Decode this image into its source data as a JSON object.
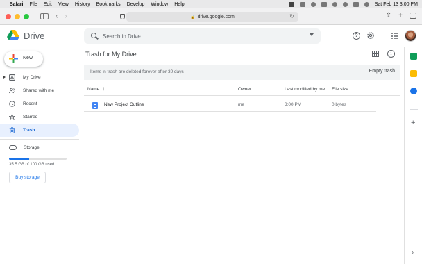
{
  "menubar": {
    "app": "Safari",
    "items": [
      "File",
      "Edit",
      "View",
      "History",
      "Bookmarks",
      "Develop",
      "Window",
      "Help"
    ],
    "clock": "Sat Feb 13  3:00 PM"
  },
  "browser": {
    "url": "drive.google.com"
  },
  "drive": {
    "logo_text": "Drive",
    "search_placeholder": "Search in Drive",
    "new_label": "New"
  },
  "nav": {
    "items": [
      {
        "label": "My Drive",
        "icon": "my-drive-icon"
      },
      {
        "label": "Shared with me",
        "icon": "shared-icon"
      },
      {
        "label": "Recent",
        "icon": "clock-icon"
      },
      {
        "label": "Starred",
        "icon": "star-icon"
      },
      {
        "label": "Trash",
        "icon": "trash-icon"
      }
    ],
    "active": "Trash"
  },
  "storage": {
    "label": "Storage",
    "used_text": "35.5 GB of 100 GB used",
    "used_fraction": 0.355,
    "buy_label": "Buy storage"
  },
  "main": {
    "title": "Trash for My Drive",
    "banner_text": "Items in trash are deleted forever after 30 days",
    "empty_trash_label": "Empty trash",
    "columns": {
      "name": "Name",
      "owner": "Owner",
      "modified": "Last modified by me",
      "size": "File size"
    },
    "rows": [
      {
        "name": "New Project Outline",
        "owner": "me",
        "modified": "3:00 PM",
        "size": "0 bytes"
      }
    ]
  },
  "colors": {
    "accent": "#1a73e8",
    "active_nav_bg": "#e8f0fe",
    "active_nav_text": "#1967d2"
  }
}
